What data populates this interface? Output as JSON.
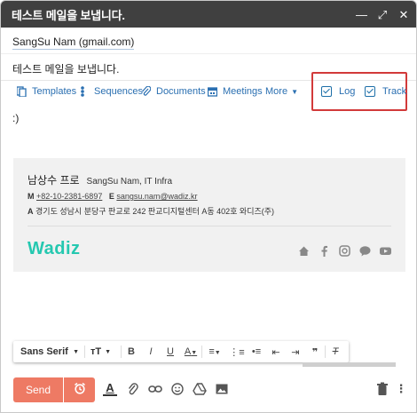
{
  "window": {
    "title": "테스트 메일을 보냅니다.",
    "controls": [
      "minimize-icon",
      "expand-icon",
      "close-icon"
    ]
  },
  "compose": {
    "to": "SangSu Nam (gmail.com)",
    "subject": "테스트 메일을 보냅니다.",
    "body": ":)"
  },
  "toolbar": {
    "templates": "Templates",
    "sequences": "Sequences",
    "documents": "Documents",
    "meetings": "Meetings",
    "more": "More"
  },
  "tracking": {
    "log": "Log",
    "track": "Track"
  },
  "signature": {
    "name_ko": "남상수 프로",
    "name_en": "SangSu Nam, IT Infra",
    "m_label": "M",
    "phone": "+82-10-2381-6897",
    "e_label": "E",
    "email": "sangsu.nam@wadiz.kr",
    "a_label": "A",
    "address": "경기도 성남시 분당구 판교로 242 판교디지털센터 A동 402호 와디즈(주)",
    "logo": "Wadiz",
    "social": [
      "home-icon",
      "facebook-icon",
      "instagram-icon",
      "chat-icon",
      "youtube-icon"
    ]
  },
  "format": {
    "font": "Sans Serif"
  },
  "footer": {
    "send": "Send"
  },
  "colors": {
    "accent": "#2a6fb1",
    "send": "#ee7a64",
    "highlight_box": "#d23a3a",
    "brand": "#25c8b0"
  }
}
